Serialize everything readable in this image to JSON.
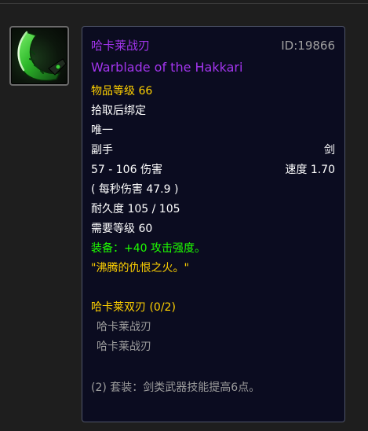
{
  "item": {
    "name_cn": "哈卡莱战刃",
    "name_en": "Warblade of the Hakkari",
    "id_label": "ID:19866",
    "item_level": "物品等级 66",
    "bind": "拾取后绑定",
    "unique": "唯一",
    "slot": "副手",
    "weapon_type": "剑",
    "damage": "57 - 106 伤害",
    "speed": "速度 1.70",
    "dps": "( 每秒伤害 47.9 )",
    "durability": "耐久度 105 / 105",
    "required_level": "需要等级 60",
    "equip_effect": "装备：+40 攻击强度。",
    "flavor_text": "\"沸腾的仇恨之火。\"",
    "set": {
      "name": "哈卡莱双刃 (0/2)",
      "pieces": [
        "哈卡莱战刃",
        "哈卡莱战刃"
      ],
      "bonus": "(2) 套装：剑类武器技能提高6点。"
    }
  },
  "icon": "hakkari-warblade-icon",
  "colors": {
    "epic_purple": "#a335ee",
    "item_level_gold": "#ffd100",
    "equip_green": "#1eff00",
    "flavor_gold": "#ffd100",
    "set_name_gold": "#ffd100",
    "inactive_grey": "#9d9d9d",
    "id_grey": "#a0a0a0",
    "tooltip_bg": "#0b0c20",
    "tooltip_border": "#4f5569"
  }
}
